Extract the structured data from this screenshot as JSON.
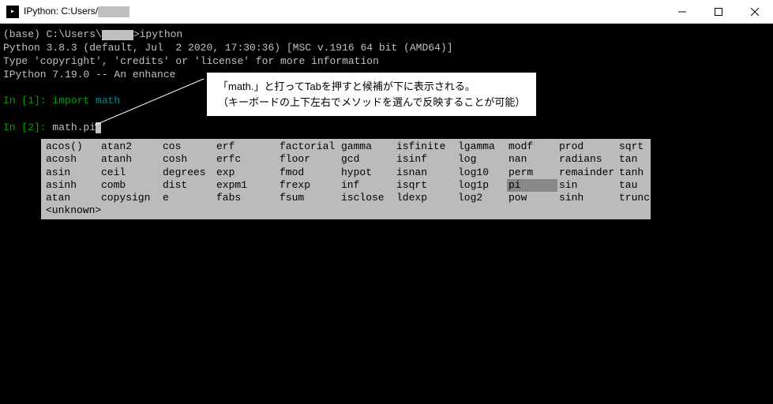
{
  "titlebar": {
    "title_prefix": "IPython: C:Users/"
  },
  "terminal": {
    "line1_prefix": "(base) C:\\Users\\",
    "line1_suffix": ">ipython",
    "line2": "Python 3.8.3 (default, Jul  2 2020, 17:30:36) [MSC v.1916 64 bit (AMD64)]",
    "line3": "Type 'copyright', 'credits' or 'license' for more information",
    "line4": "IPython 7.19.0 -- An enhance",
    "prompt1_label": "In [1]: ",
    "prompt1_import": "import ",
    "prompt1_module": "math",
    "prompt2_label": "In [2]: ",
    "prompt2_text": "math.pi"
  },
  "annotation": {
    "line1": "「math.」と打ってTabを押すと候補が下に表示される。",
    "line2": "（キーボードの上下左右でメソッドを選んで反映することが可能）"
  },
  "completion": {
    "rows": [
      [
        "acos()",
        "atan2",
        "cos",
        "erf",
        "factorial",
        "gamma",
        "isfinite",
        "lgamma",
        "modf",
        "prod",
        "sqrt"
      ],
      [
        "acosh",
        "atanh",
        "cosh",
        "erfc",
        "floor",
        "gcd",
        "isinf",
        "log",
        "nan",
        "radians",
        "tan"
      ],
      [
        "asin",
        "ceil",
        "degrees",
        "exp",
        "fmod",
        "hypot",
        "isnan",
        "log10",
        "perm",
        "remainder",
        "tanh"
      ],
      [
        "asinh",
        "comb",
        "dist",
        "expm1",
        "frexp",
        "inf",
        "isqrt",
        "log1p",
        "pi",
        "sin",
        "tau"
      ],
      [
        "atan",
        "copysign",
        "e",
        "fabs",
        "fsum",
        "isclose",
        "ldexp",
        "log2",
        "pow",
        "sinh",
        "trunc"
      ]
    ],
    "unknown": "<unknown>",
    "selected_row": 3,
    "selected_col": 8
  }
}
